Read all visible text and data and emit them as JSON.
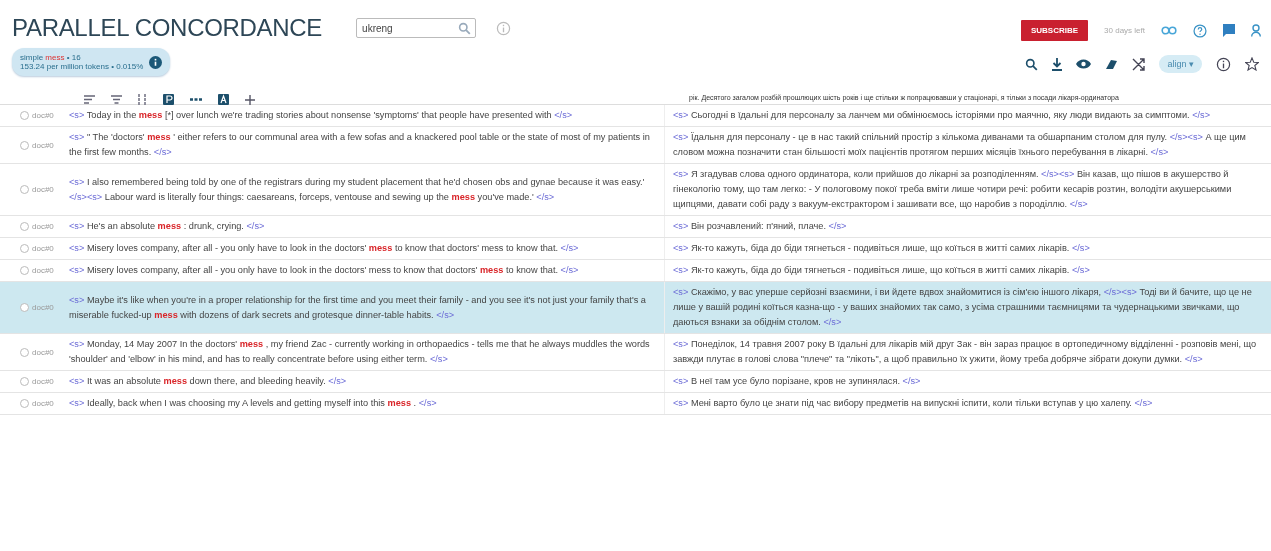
{
  "header": {
    "title": "PARALLEL CONCORDANCE",
    "search": {
      "value": "ukreng"
    },
    "subscribe": "SUBSCRIBE",
    "trial": "30 days left"
  },
  "summary": {
    "query_type": "simple",
    "query": "mess",
    "hits": "• 16",
    "frequency": "153.24 per million tokens • 0.015%"
  },
  "toolbar": {
    "align": "align",
    "align_caret": "▾"
  },
  "right_header": "рік. Десятого загалом розбій прошлюцих шість років і ще стільки ж попрацювавши у стаціонарі, я тільки з посади лікаря-ординатора",
  "rows": [
    {
      "doc": "doc#0",
      "selected": false,
      "left": [
        {
          "kind": "tag",
          "text": "<s>"
        },
        {
          "kind": "text",
          "text": "Today in the"
        },
        {
          "kind": "hit",
          "text": "mess"
        },
        {
          "kind": "text",
          "text": "[*] over lunch we're trading stories about nonsense 'symptoms' that people have presented with"
        },
        {
          "kind": "tag",
          "text": "</s>"
        }
      ],
      "right": [
        {
          "kind": "tag",
          "text": "<s>"
        },
        {
          "kind": "text",
          "text": "Сьогодні в їдальні для персоналу за ланчем ми обмінюємось історіями про маячню, яку люди видають за симптоми."
        },
        {
          "kind": "tag",
          "text": "</s>"
        }
      ]
    },
    {
      "doc": "doc#0",
      "selected": false,
      "left": [
        {
          "kind": "tag",
          "text": "<s>"
        },
        {
          "kind": "text",
          "text": "\" The 'doctors'"
        },
        {
          "kind": "hit",
          "text": "mess"
        },
        {
          "kind": "text",
          "text": "' either refers to our communal area with a few sofas and a knackered pool table or the state of most of my patients in the first few months."
        },
        {
          "kind": "tag",
          "text": "</s>"
        }
      ],
      "right": [
        {
          "kind": "tag",
          "text": "<s>"
        },
        {
          "kind": "text",
          "text": "Їдальня для персоналу - це в нас такий спільний простір з кількома диванами та обшарпаним столом для пулу."
        },
        {
          "kind": "tag",
          "text": "</s><s>"
        },
        {
          "kind": "text",
          "text": "А ще цим словом можна позначити стан більшості моїх пацієнтів протягом перших місяців їхнього перебування в лікарні."
        },
        {
          "kind": "tag",
          "text": "</s>"
        }
      ]
    },
    {
      "doc": "doc#0",
      "selected": false,
      "left": [
        {
          "kind": "tag",
          "text": "<s>"
        },
        {
          "kind": "text",
          "text": "I also remembered being told by one of the registrars during my student placement that he'd chosen obs and gynae because it was easy.'"
        },
        {
          "kind": "tag",
          "text": "</s><s>"
        },
        {
          "kind": "text",
          "text": "Labour ward is literally four things: caesareans, forceps, ventouse and sewing up the"
        },
        {
          "kind": "hit",
          "text": "mess"
        },
        {
          "kind": "text",
          "text": "you've made.'"
        },
        {
          "kind": "tag",
          "text": "</s>"
        }
      ],
      "right": [
        {
          "kind": "tag",
          "text": "<s>"
        },
        {
          "kind": "text",
          "text": "Я згадував слова одного ординатора, коли прийшов до лікарні за розподіленням."
        },
        {
          "kind": "tag",
          "text": "</s><s>"
        },
        {
          "kind": "text",
          "text": "Він казав, що пішов в акушерство й гінекологію тому, що там легко: - У пологовому покої треба вміти лише чотири речі: робити кесарів розтин, володіти акушерськими щипцями, давати собі раду з вакуум-екстрактором і зашивати все, що наробив з породіллю."
        },
        {
          "kind": "tag",
          "text": "</s>"
        }
      ]
    },
    {
      "doc": "doc#0",
      "selected": false,
      "left": [
        {
          "kind": "tag",
          "text": "<s>"
        },
        {
          "kind": "text",
          "text": "He's an absolute"
        },
        {
          "kind": "hit",
          "text": "mess"
        },
        {
          "kind": "text",
          "text": ": drunk, crying."
        },
        {
          "kind": "tag",
          "text": "</s>"
        }
      ],
      "right": [
        {
          "kind": "tag",
          "text": "<s>"
        },
        {
          "kind": "text",
          "text": "Він розчавлений: п'яний, плаче."
        },
        {
          "kind": "tag",
          "text": "</s>"
        }
      ]
    },
    {
      "doc": "doc#0",
      "selected": false,
      "left": [
        {
          "kind": "tag",
          "text": "<s>"
        },
        {
          "kind": "text",
          "text": "Misery loves company, after all - you only have to look in the doctors'"
        },
        {
          "kind": "hit",
          "text": "mess"
        },
        {
          "kind": "text",
          "text": "to know that doctors' mess to know that."
        },
        {
          "kind": "tag",
          "text": "</s>"
        }
      ],
      "right": [
        {
          "kind": "tag",
          "text": "<s>"
        },
        {
          "kind": "text",
          "text": "Як-то кажуть, біда до біди тягнеться - подивіться лише, що коїться в житті самих лікарів."
        },
        {
          "kind": "tag",
          "text": "</s>"
        }
      ]
    },
    {
      "doc": "doc#0",
      "selected": false,
      "left": [
        {
          "kind": "tag",
          "text": "<s>"
        },
        {
          "kind": "text",
          "text": "Misery loves company, after all - you only have to look in the doctors' mess to know that doctors'"
        },
        {
          "kind": "hit",
          "text": "mess"
        },
        {
          "kind": "text",
          "text": "to know that."
        },
        {
          "kind": "tag",
          "text": "</s>"
        }
      ],
      "right": [
        {
          "kind": "tag",
          "text": "<s>"
        },
        {
          "kind": "text",
          "text": "Як-то кажуть, біда до біди тягнеться - подивіться лише, що коїться в житті самих лікарів."
        },
        {
          "kind": "tag",
          "text": "</s>"
        }
      ]
    },
    {
      "doc": "doc#0",
      "selected": true,
      "left": [
        {
          "kind": "tag",
          "text": "<s>"
        },
        {
          "kind": "text",
          "text": "Maybe it's like when you're in a proper relationship for the first time and you meet their family - and you see it's not just your family that's a miserable fucked-up"
        },
        {
          "kind": "hit",
          "text": "mess"
        },
        {
          "kind": "text",
          "text": "with dozens of dark secrets and grotesque dinner-table habits."
        },
        {
          "kind": "tag",
          "text": "</s>"
        }
      ],
      "right": [
        {
          "kind": "tag",
          "text": "<s>"
        },
        {
          "kind": "text",
          "text": "Скажімо, у вас уперше серйозні взаємини, і ви йдете вдвох знайомитися із сім'єю іншого лікаря,"
        },
        {
          "kind": "tag",
          "text": "</s><s>"
        },
        {
          "kind": "text",
          "text": "Тоді ви й бачите, що це не лише у вашій родині коїться казна-що - у ваших знайомих так само, з усіма страшними таємницями та чудернацькими звичками, що даються взнаки за обіднім столом."
        },
        {
          "kind": "tag",
          "text": "</s>"
        }
      ]
    },
    {
      "doc": "doc#0",
      "selected": false,
      "left": [
        {
          "kind": "tag",
          "text": "<s>"
        },
        {
          "kind": "text",
          "text": "Monday, 14 May 2007 In the doctors'"
        },
        {
          "kind": "hit",
          "text": "mess"
        },
        {
          "kind": "text",
          "text": ", my friend Zac - currently working in orthopaedics - tells me that he always muddles the words 'shoulder' and 'elbow' in his mind, and has to really concentrate before using either term."
        },
        {
          "kind": "tag",
          "text": "</s>"
        }
      ],
      "right": [
        {
          "kind": "tag",
          "text": "<s>"
        },
        {
          "kind": "text",
          "text": "Понеділок, 14 травня 2007 року В їдальні для лікарів мій друг Зак - він зараз працює в ортопедичному відділенні - розповів мені, що завжди плутає в голові слова \"плече\" та \"лікоть\", а щоб правильно їх ужити, йому треба добряче зібрати докупи думки."
        },
        {
          "kind": "tag",
          "text": "</s>"
        }
      ]
    },
    {
      "doc": "doc#0",
      "selected": false,
      "left": [
        {
          "kind": "tag",
          "text": "<s>"
        },
        {
          "kind": "text",
          "text": "It was an absolute"
        },
        {
          "kind": "hit",
          "text": "mess"
        },
        {
          "kind": "text",
          "text": "down there, and bleeding heavily."
        },
        {
          "kind": "tag",
          "text": "</s>"
        }
      ],
      "right": [
        {
          "kind": "tag",
          "text": "<s>"
        },
        {
          "kind": "text",
          "text": "В неї там усе було порізане, кров не зупинялася."
        },
        {
          "kind": "tag",
          "text": "</s>"
        }
      ]
    },
    {
      "doc": "doc#0",
      "selected": false,
      "left": [
        {
          "kind": "tag",
          "text": "<s>"
        },
        {
          "kind": "text",
          "text": "Ideally, back when I was choosing my A levels and getting myself into this"
        },
        {
          "kind": "hit",
          "text": "mess"
        },
        {
          "kind": "text",
          "text": "."
        },
        {
          "kind": "tag",
          "text": "</s>"
        }
      ],
      "right": [
        {
          "kind": "tag",
          "text": "<s>"
        },
        {
          "kind": "text",
          "text": "Мені варто було це знати під час вибору предметів на випускні іспити, коли тільки вступав у цю халепу."
        },
        {
          "kind": "tag",
          "text": "</s>"
        }
      ]
    }
  ]
}
